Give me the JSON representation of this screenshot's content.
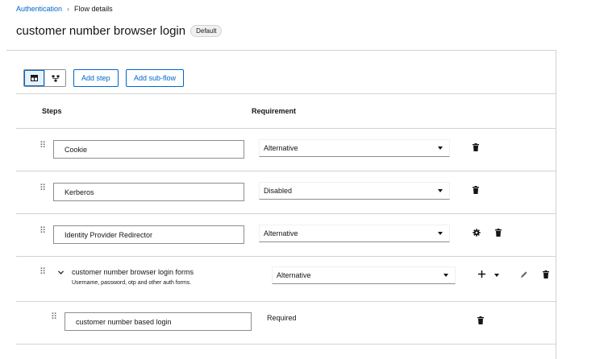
{
  "breadcrumb": {
    "parent": "Authentication",
    "separator": "›",
    "current": "Flow details"
  },
  "page": {
    "title": "customer number browser login",
    "badge": "Default"
  },
  "toolbar": {
    "table_view_icon": "table-icon",
    "diagram_view_icon": "diagram-icon",
    "add_step_label": "Add step",
    "add_subflow_label": "Add sub-flow"
  },
  "table": {
    "headers": {
      "steps": "Steps",
      "requirement": "Requirement"
    },
    "rows": [
      {
        "name": "Cookie",
        "requirement": "Alternative",
        "actions": [
          "trash-icon"
        ]
      },
      {
        "name": "Kerberos",
        "requirement": "Disabled",
        "actions": [
          "trash-icon"
        ]
      },
      {
        "name": "Identity Provider Redirector",
        "requirement": "Alternative",
        "actions": [
          "gear-icon",
          "trash-icon"
        ]
      },
      {
        "name": "customer number browser login forms",
        "description": "Username, password, otp and other auth forms.",
        "requirement": "Alternative",
        "actions": [
          "plus-icon",
          "caret-down-icon",
          "pencil-icon",
          "trash-icon"
        ]
      },
      {
        "name": "customer number based login",
        "requirement": "Required",
        "actions": [
          "trash-icon"
        ]
      }
    ]
  },
  "colors": {
    "link": "#0066cc",
    "border": "#d2d2d2",
    "text": "#151515"
  }
}
